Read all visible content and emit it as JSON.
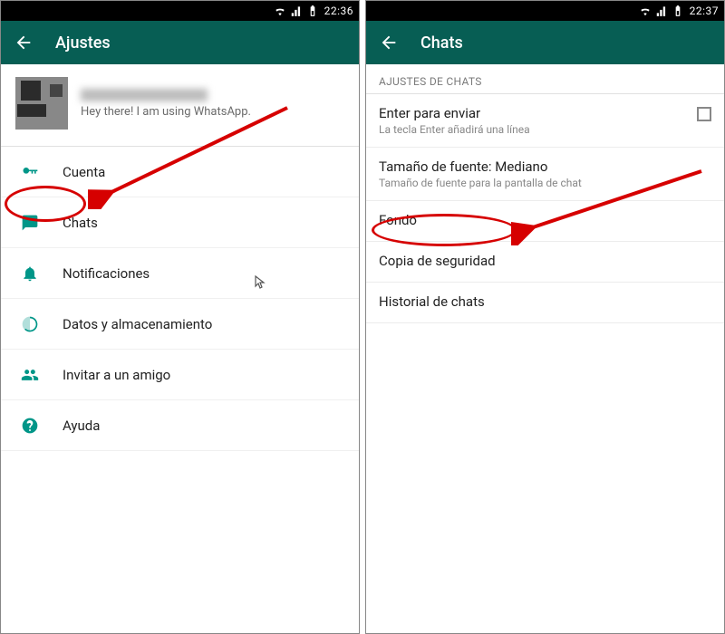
{
  "statusbar": {
    "time_left": "22:36",
    "time_right": "22:37"
  },
  "left": {
    "appbar_title": "Ajustes",
    "profile_status": "Hey there! I am using WhatsApp.",
    "items": {
      "account": "Cuenta",
      "chats": "Chats",
      "notif": "Notificaciones",
      "data": "Datos y almacenamiento",
      "invite": "Invitar a un amigo",
      "help": "Ayuda"
    }
  },
  "right": {
    "appbar_title": "Chats",
    "section_header": "AJUSTES DE CHATS",
    "enter_title": "Enter para enviar",
    "enter_sub": "La tecla Enter añadirá una línea",
    "font_title": "Tamaño de fuente: Mediano",
    "font_sub": "Tamaño de fuente para la pantalla de chat",
    "wallpaper": "Fondo",
    "backup": "Copia de seguridad",
    "history": "Historial de chats"
  }
}
